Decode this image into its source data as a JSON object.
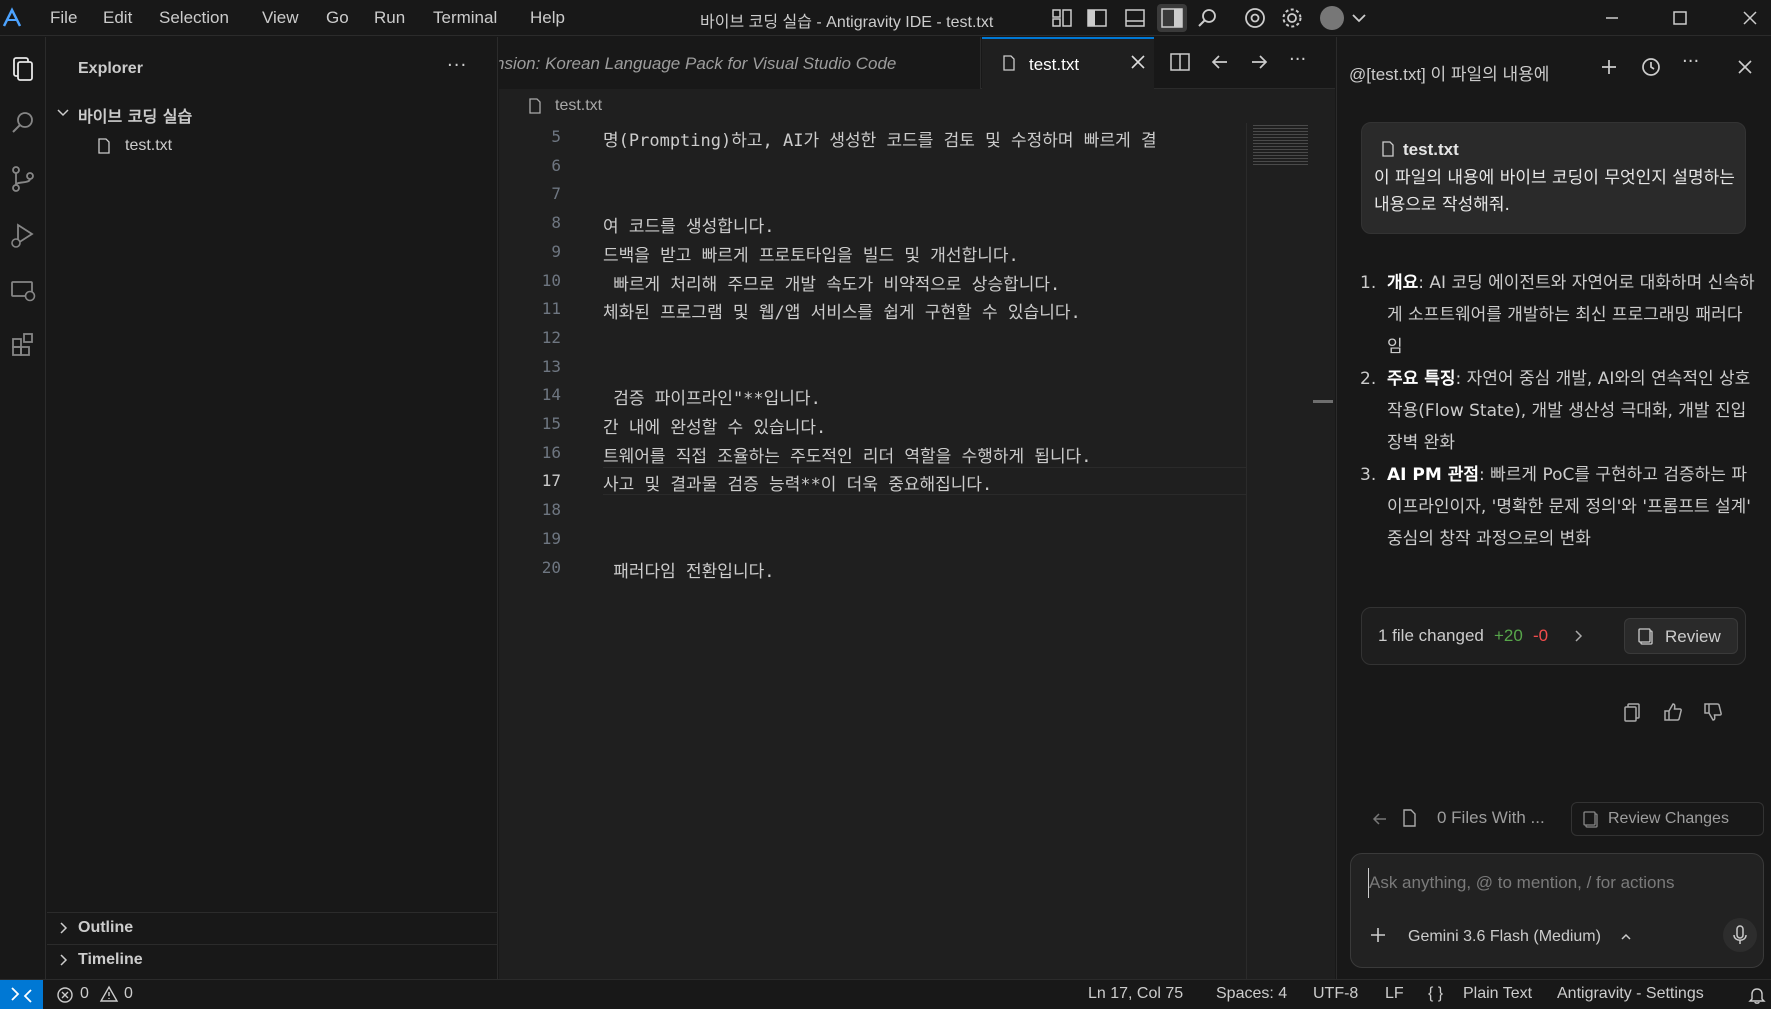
{
  "titlebar": {
    "menu": [
      "File",
      "Edit",
      "Selection",
      "View",
      "Go",
      "Run",
      "Terminal",
      "Help"
    ],
    "window_title": "바이브 코딩 실습 - Antigravity IDE - test.txt"
  },
  "sidebar": {
    "title": "Explorer",
    "folder": "바이브 코딩 실습",
    "file": "test.txt",
    "sections": [
      "Outline",
      "Timeline"
    ]
  },
  "editor": {
    "tabs": [
      {
        "label": "nsion: Korean Language Pack for Visual Studio Code",
        "active": false
      },
      {
        "label": "test.txt",
        "active": true
      }
    ],
    "breadcrumb": "test.txt",
    "lines": [
      {
        "n": "5",
        "text": "명(Prompting)하고, AI가 생성한 코드를 검토 및 수정하며 빠르게 결"
      },
      {
        "n": "6",
        "text": ""
      },
      {
        "n": "7",
        "text": ""
      },
      {
        "n": "8",
        "text": "여 코드를 생성합니다."
      },
      {
        "n": "9",
        "text": "드백을 받고 빠르게 프로토타입을 빌드 및 개선합니다."
      },
      {
        "n": "10",
        "text": " 빠르게 처리해 주므로 개발 속도가 비약적으로 상승합니다."
      },
      {
        "n": "11",
        "text": "체화된 프로그램 및 웹/앱 서비스를 쉽게 구현할 수 있습니다."
      },
      {
        "n": "12",
        "text": ""
      },
      {
        "n": "13",
        "text": ""
      },
      {
        "n": "14",
        "text": " 검증 파이프라인\"**입니다."
      },
      {
        "n": "15",
        "text": "간 내에 완성할 수 있습니다."
      },
      {
        "n": "16",
        "text": "트웨어를 직접 조율하는 주도적인 리더 역할을 수행하게 됩니다."
      },
      {
        "n": "17",
        "text": "사고 및 결과물 검증 능력**이 더욱 중요해집니다."
      },
      {
        "n": "18",
        "text": ""
      },
      {
        "n": "19",
        "text": ""
      },
      {
        "n": "20",
        "text": " 패러다임 전환입니다."
      }
    ],
    "active_line": "17"
  },
  "chat": {
    "title": "@[test.txt] 이 파일의 내용에",
    "user_message": {
      "file": "test.txt",
      "text": "이 파일의 내용에 바이브 코딩이 무엇인지 설명하는 내용으로 작성해줘."
    },
    "answer": [
      {
        "num": "1.",
        "head": "개요",
        "body": ": AI 코딩 에이전트와 자연어로 대화하며 신속하게 소프트웨어를 개발하는 최신 프로그래밍 패러다임"
      },
      {
        "num": "2.",
        "head": "주요 특징",
        "body": ": 자연어 중심 개발, AI와의 연속적인 상호작용(Flow State), 개발 생산성 극대화, 개발 진입장벽 완화"
      },
      {
        "num": "3.",
        "head": "AI PM 관점",
        "body": ": 빠르게 PoC를 구현하고 검증하는 파이프라인이자, '명확한 문제 정의'와 '프롬프트 설계' 중심의 창작 과정으로의 변화"
      }
    ],
    "changes": {
      "label": "1 file changed",
      "plus": "+20",
      "minus": "-0",
      "review": "Review"
    },
    "files_bar": {
      "label": "0 Files With ...",
      "review_changes": "Review Changes"
    },
    "input": {
      "placeholder": "Ask anything, @ to mention, / for actions",
      "model": "Gemini 3.6 Flash (Medium)"
    }
  },
  "statusbar": {
    "errors": "0",
    "warnings": "0",
    "position": "Ln 17, Col 75",
    "spaces": "Spaces: 4",
    "encoding": "UTF-8",
    "eol": "LF",
    "language": "Plain Text",
    "settings": "Antigravity - Settings"
  }
}
